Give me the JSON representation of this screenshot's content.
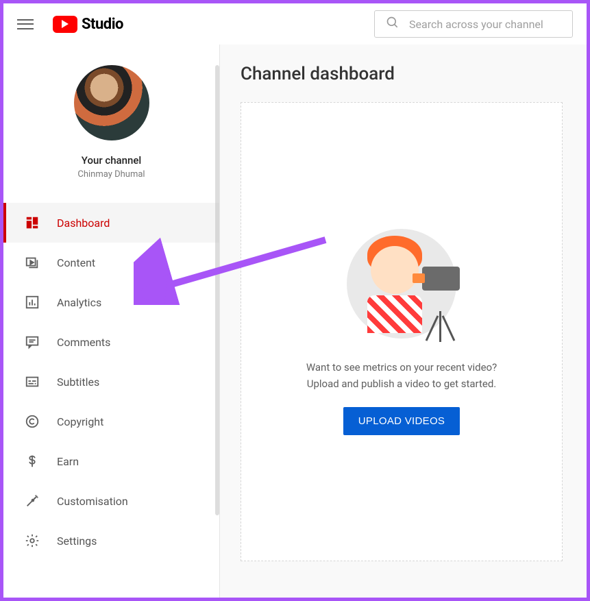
{
  "header": {
    "brand": "Studio",
    "search_placeholder": "Search across your channel"
  },
  "sidebar": {
    "your_channel_label": "Your channel",
    "channel_name": "Chinmay Dhumal",
    "items": [
      {
        "label": "Dashboard",
        "icon": "dashboard-icon",
        "active": true
      },
      {
        "label": "Content",
        "icon": "content-icon"
      },
      {
        "label": "Analytics",
        "icon": "analytics-icon"
      },
      {
        "label": "Comments",
        "icon": "comments-icon"
      },
      {
        "label": "Subtitles",
        "icon": "subtitles-icon"
      },
      {
        "label": "Copyright",
        "icon": "copyright-icon"
      },
      {
        "label": "Earn",
        "icon": "earn-icon"
      },
      {
        "label": "Customisation",
        "icon": "customisation-icon"
      },
      {
        "label": "Settings",
        "icon": "settings-icon"
      }
    ]
  },
  "main": {
    "title": "Channel dashboard",
    "prompt_line1": "Want to see metrics on your recent video?",
    "prompt_line2": "Upload and publish a video to get started.",
    "upload_button": "UPLOAD VIDEOS"
  }
}
